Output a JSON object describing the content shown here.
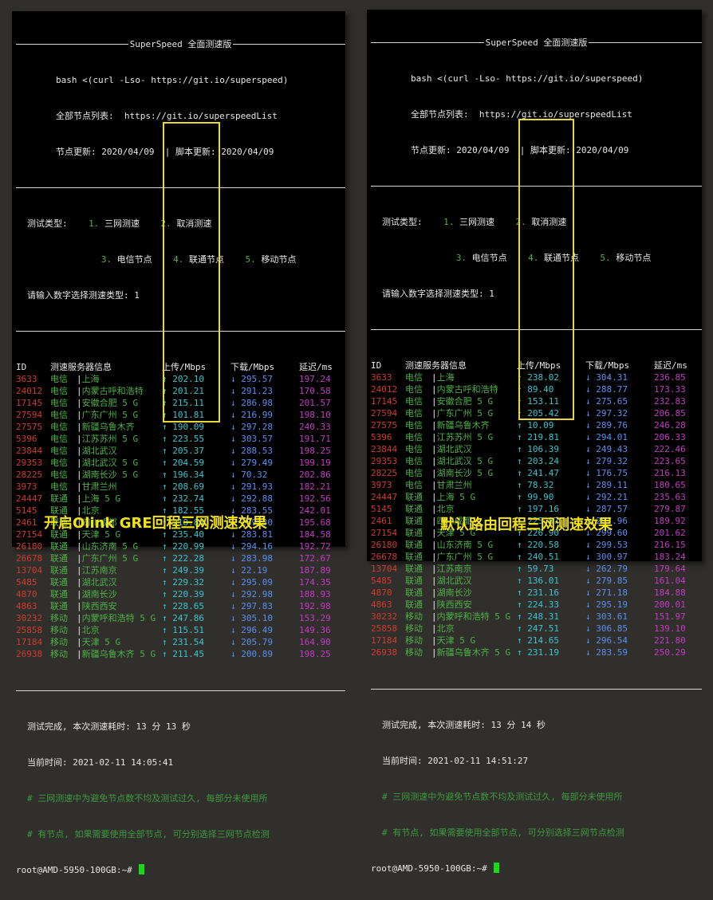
{
  "header": {
    "title": "SuperSpeed 全面测速版",
    "cmd": "bash <(curl -Lso- https://git.io/superspeed)"
  },
  "menu": {
    "type_label": "测试类型:",
    "opt1": "1. 三网测速",
    "opt2": "2. 取消测速",
    "opt3": "3. 电信节点",
    "opt4": "4. 联通节点",
    "opt5": "5. 移动节点",
    "prompt": "请输入数字选择测速类型: 1"
  },
  "columns": {
    "id": "ID",
    "server": "测速服务器信息",
    "upload": "上传/Mbps",
    "download": "下载/Mbps",
    "latency": "延迟/ms"
  },
  "left": {
    "list_line": "全部节点列表:  https://git.io/superspeedList",
    "update_line": "节点更新: 2020/04/09  | 脚本更新: 2020/04/09",
    "rows": [
      {
        "id": "3633",
        "isp": "电信",
        "loc": "上海",
        "up": "↑ 202.10",
        "down": "↓ 295.57",
        "lat": "197.24"
      },
      {
        "id": "24012",
        "isp": "电信",
        "loc": "内蒙古呼和浩特",
        "up": "↑ 201.21",
        "down": "↓ 291.23",
        "lat": "170.58"
      },
      {
        "id": "17145",
        "isp": "电信",
        "loc": "安徽合肥 5 G",
        "up": "↑ 215.11",
        "down": "↓ 286.98",
        "lat": "201.57"
      },
      {
        "id": "27594",
        "isp": "电信",
        "loc": "广东广州 5 G",
        "up": "↑ 101.81",
        "down": "↓ 216.99",
        "lat": "198.10"
      },
      {
        "id": "27575",
        "isp": "电信",
        "loc": "新疆乌鲁木齐",
        "up": "↑ 190.09",
        "down": "↓ 297.28",
        "lat": "240.33"
      },
      {
        "id": "5396",
        "isp": "电信",
        "loc": "江苏苏州 5 G",
        "up": "↑ 223.55",
        "down": "↓ 303.57",
        "lat": "191.71"
      },
      {
        "id": "23844",
        "isp": "电信",
        "loc": "湖北武汉",
        "up": "↑ 205.37",
        "down": "↓ 288.53",
        "lat": "198.25"
      },
      {
        "id": "29353",
        "isp": "电信",
        "loc": "湖北武汉 5 G",
        "up": "↑ 204.59",
        "down": "↓ 279.49",
        "lat": "199.19"
      },
      {
        "id": "28225",
        "isp": "电信",
        "loc": "湖南长沙 5 G",
        "up": "↑ 196.34",
        "down": "↓ 70.32",
        "lat": "202.86"
      },
      {
        "id": "3973",
        "isp": "电信",
        "loc": "甘肃兰州",
        "up": "↑ 208.69",
        "down": "↓ 291.93",
        "lat": "182.21"
      },
      {
        "id": "24447",
        "isp": "联通",
        "loc": "上海 5 G",
        "up": "↑ 232.74",
        "down": "↓ 292.88",
        "lat": "192.56"
      },
      {
        "id": "5145",
        "isp": "联通",
        "loc": "北京",
        "up": "↑ 182.55",
        "down": "↓ 283.55",
        "lat": "242.01"
      },
      {
        "id": "2461",
        "isp": "联通",
        "loc": "四川成都",
        "up": "↑ 218.84",
        "down": "↓ 289.30",
        "lat": "195.68"
      },
      {
        "id": "27154",
        "isp": "联通",
        "loc": "天津 5 G",
        "up": "↑ 235.40",
        "down": "↓ 283.81",
        "lat": "184.58"
      },
      {
        "id": "26180",
        "isp": "联通",
        "loc": "山东济南 5 G",
        "up": "↑ 220.99",
        "down": "↓ 294.16",
        "lat": "192.72"
      },
      {
        "id": "26678",
        "isp": "联通",
        "loc": "广东广州 5 G",
        "up": "↑ 222.28",
        "down": "↓ 283.98",
        "lat": "172.67"
      },
      {
        "id": "13704",
        "isp": "联通",
        "loc": "江苏南京",
        "up": "↑ 249.39",
        "down": "↓ 22.19",
        "lat": "187.89"
      },
      {
        "id": "5485",
        "isp": "联通",
        "loc": "湖北武汉",
        "up": "↑ 229.32",
        "down": "↓ 295.09",
        "lat": "174.35"
      },
      {
        "id": "4870",
        "isp": "联通",
        "loc": "湖南长沙",
        "up": "↑ 220.39",
        "down": "↓ 292.98",
        "lat": "188.93"
      },
      {
        "id": "4863",
        "isp": "联通",
        "loc": "陕西西安",
        "up": "↑ 228.65",
        "down": "↓ 297.83",
        "lat": "192.98"
      },
      {
        "id": "30232",
        "isp": "移动",
        "loc": "内蒙呼和浩特 5 G",
        "up": "↑ 247.86",
        "down": "↓ 305.10",
        "lat": "153.29"
      },
      {
        "id": "25858",
        "isp": "移动",
        "loc": "北京",
        "up": "↑ 115.51",
        "down": "↓ 296.49",
        "lat": "149.36"
      },
      {
        "id": "17184",
        "isp": "移动",
        "loc": "天津 5 G",
        "up": "↑ 231.54",
        "down": "↓ 205.79",
        "lat": "164.90"
      },
      {
        "id": "26938",
        "isp": "移动",
        "loc": "新疆乌鲁木齐 5 G",
        "up": "↑ 211.45",
        "down": "↓ 200.89",
        "lat": "198.25"
      }
    ],
    "done": "测试完成, 本次测速耗时: 13 分 13 秒",
    "time": "当前时间: 2021-02-11 14:05:41",
    "note1": "# 三网测速中为避免节点数不均及测试过久, 每部分未使用所",
    "note2": "# 有节点, 如果需要使用全部节点, 可分别选择三网节点检测",
    "prompt": "root@AMD-5950-100GB:~#",
    "caption": "开启Olink GRE回程三网测速效果"
  },
  "right": {
    "list_line": "全部节点列表:  https://git.io/superspeedList",
    "update_line": "节点更新: 2020/04/09  | 脚本更新: 2020/04/09",
    "rows": [
      {
        "id": "3633",
        "isp": "电信",
        "loc": "上海",
        "up": "↑ 238.02",
        "down": "↓ 304.31",
        "lat": "236.85"
      },
      {
        "id": "24012",
        "isp": "电信",
        "loc": "内蒙古呼和浩特",
        "up": "↑ 89.40",
        "down": "↓ 288.77",
        "lat": "173.33"
      },
      {
        "id": "17145",
        "isp": "电信",
        "loc": "安徽合肥 5 G",
        "up": "↑ 153.11",
        "down": "↓ 275.65",
        "lat": "232.83"
      },
      {
        "id": "27594",
        "isp": "电信",
        "loc": "广东广州 5 G",
        "up": "↑ 205.42",
        "down": "↓ 297.32",
        "lat": "206.85"
      },
      {
        "id": "27575",
        "isp": "电信",
        "loc": "新疆乌鲁木齐",
        "up": "↑ 10.09",
        "down": "↓ 289.76",
        "lat": "246.28"
      },
      {
        "id": "5396",
        "isp": "电信",
        "loc": "江苏苏州 5 G",
        "up": "↑ 219.81",
        "down": "↓ 294.01",
        "lat": "206.33"
      },
      {
        "id": "23844",
        "isp": "电信",
        "loc": "湖北武汉",
        "up": "↑ 106.39",
        "down": "↓ 249.43",
        "lat": "222.46"
      },
      {
        "id": "29353",
        "isp": "电信",
        "loc": "湖北武汉 5 G",
        "up": "↑ 203.24",
        "down": "↓ 279.32",
        "lat": "223.65"
      },
      {
        "id": "28225",
        "isp": "电信",
        "loc": "湖南长沙 5 G",
        "up": "↑ 241.47",
        "down": "↓ 176.75",
        "lat": "216.13"
      },
      {
        "id": "3973",
        "isp": "电信",
        "loc": "甘肃兰州",
        "up": "↑ 78.32",
        "down": "↓ 289.11",
        "lat": "180.65"
      },
      {
        "id": "24447",
        "isp": "联通",
        "loc": "上海 5 G",
        "up": "↑ 99.90",
        "down": "↓ 292.21",
        "lat": "235.63"
      },
      {
        "id": "5145",
        "isp": "联通",
        "loc": "北京",
        "up": "↑ 197.16",
        "down": "↓ 287.57",
        "lat": "279.87"
      },
      {
        "id": "2461",
        "isp": "联通",
        "loc": "四川成都",
        "up": "↑ 225.07",
        "down": "↓ 297.96",
        "lat": "189.92"
      },
      {
        "id": "27154",
        "isp": "联通",
        "loc": "天津 5 G",
        "up": "↑ 226.90",
        "down": "↓ 299.60",
        "lat": "201.62"
      },
      {
        "id": "26180",
        "isp": "联通",
        "loc": "山东济南 5 G",
        "up": "↑ 220.58",
        "down": "↓ 299.53",
        "lat": "216.15"
      },
      {
        "id": "26678",
        "isp": "联通",
        "loc": "广东广州 5 G",
        "up": "↑ 240.51",
        "down": "↓ 300.97",
        "lat": "183.24"
      },
      {
        "id": "13704",
        "isp": "联通",
        "loc": "江苏南京",
        "up": "↑ 59.73",
        "down": "↓ 262.79",
        "lat": "179.64"
      },
      {
        "id": "5485",
        "isp": "联通",
        "loc": "湖北武汉",
        "up": "↑ 136.01",
        "down": "↓ 279.85",
        "lat": "161.04"
      },
      {
        "id": "4870",
        "isp": "联通",
        "loc": "湖南长沙",
        "up": "↑ 231.16",
        "down": "↓ 271.18",
        "lat": "184.88"
      },
      {
        "id": "4863",
        "isp": "联通",
        "loc": "陕西西安",
        "up": "↑ 224.33",
        "down": "↓ 295.19",
        "lat": "200.01"
      },
      {
        "id": "30232",
        "isp": "移动",
        "loc": "内蒙呼和浩特 5 G",
        "up": "↑ 248.31",
        "down": "↓ 303.61",
        "lat": "151.97"
      },
      {
        "id": "25858",
        "isp": "移动",
        "loc": "北京",
        "up": "↑ 247.51",
        "down": "↓ 306.85",
        "lat": "139.10"
      },
      {
        "id": "17184",
        "isp": "移动",
        "loc": "天津 5 G",
        "up": "↑ 214.65",
        "down": "↓ 296.54",
        "lat": "221.80"
      },
      {
        "id": "26938",
        "isp": "移动",
        "loc": "新疆乌鲁木齐 5 G",
        "up": "↑ 231.19",
        "down": "↓ 283.59",
        "lat": "250.29"
      }
    ],
    "done": "测试完成, 本次测速耗时: 13 分 14 秒",
    "time": "当前时间: 2021-02-11 14:51:27",
    "note1": "# 三网测速中为避免节点数不均及测试过久, 每部分未使用所",
    "note2": "# 有节点, 如果需要使用全部节点, 可分别选择三网节点检测",
    "prompt": "root@AMD-5950-100GB:~#",
    "caption": "默认路由回程三网测速效果"
  },
  "colors": {
    "id": "#d23a2f",
    "location": "#4fb148",
    "upload": "#37c6cf",
    "download": "#5b8ff2",
    "latency": "#c63ac4",
    "highlight": "#e9d63a",
    "caption": "#f2e21a",
    "cursor": "#18d818"
  }
}
